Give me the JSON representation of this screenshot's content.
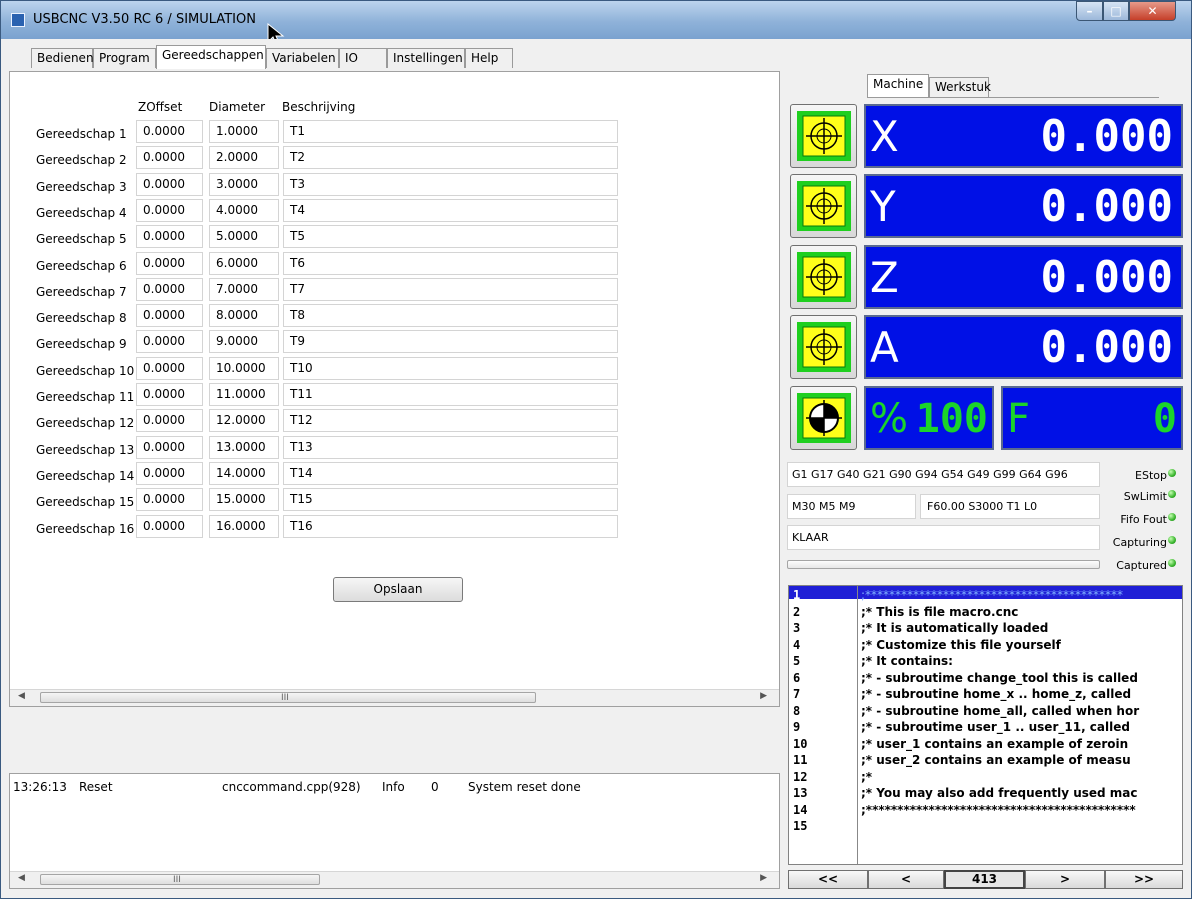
{
  "window": {
    "title": "USBCNC V3.50 RC 6 / SIMULATION"
  },
  "tabs": [
    "Bedienen",
    "Program",
    "Gereedschappen",
    "Variabelen",
    "IO",
    "Instellingen",
    "Help"
  ],
  "tools_table": {
    "headers": {
      "zoffset": "ZOffset",
      "diameter": "Diameter",
      "description": "Beschrijving"
    },
    "rows": [
      {
        "label": "Gereedschap 1",
        "zoffset": "0.0000",
        "diameter": "1.0000",
        "desc": "T1"
      },
      {
        "label": "Gereedschap 2",
        "zoffset": "0.0000",
        "diameter": "2.0000",
        "desc": "T2"
      },
      {
        "label": "Gereedschap 3",
        "zoffset": "0.0000",
        "diameter": "3.0000",
        "desc": "T3"
      },
      {
        "label": "Gereedschap 4",
        "zoffset": "0.0000",
        "diameter": "4.0000",
        "desc": "T4"
      },
      {
        "label": "Gereedschap 5",
        "zoffset": "0.0000",
        "diameter": "5.0000",
        "desc": "T5"
      },
      {
        "label": "Gereedschap 6",
        "zoffset": "0.0000",
        "diameter": "6.0000",
        "desc": "T6"
      },
      {
        "label": "Gereedschap 7",
        "zoffset": "0.0000",
        "diameter": "7.0000",
        "desc": "T7"
      },
      {
        "label": "Gereedschap 8",
        "zoffset": "0.0000",
        "diameter": "8.0000",
        "desc": "T8"
      },
      {
        "label": "Gereedschap 9",
        "zoffset": "0.0000",
        "diameter": "9.0000",
        "desc": "T9"
      },
      {
        "label": "Gereedschap 10",
        "zoffset": "0.0000",
        "diameter": "10.0000",
        "desc": "T10"
      },
      {
        "label": "Gereedschap 11",
        "zoffset": "0.0000",
        "diameter": "11.0000",
        "desc": "T11"
      },
      {
        "label": "Gereedschap 12",
        "zoffset": "0.0000",
        "diameter": "12.0000",
        "desc": "T12"
      },
      {
        "label": "Gereedschap 13",
        "zoffset": "0.0000",
        "diameter": "13.0000",
        "desc": "T13"
      },
      {
        "label": "Gereedschap 14",
        "zoffset": "0.0000",
        "diameter": "14.0000",
        "desc": "T14"
      },
      {
        "label": "Gereedschap 15",
        "zoffset": "0.0000",
        "diameter": "15.0000",
        "desc": "T15"
      },
      {
        "label": "Gereedschap 16",
        "zoffset": "0.0000",
        "diameter": "16.0000",
        "desc": "T16"
      }
    ],
    "save_label": "Opslaan"
  },
  "log": {
    "time": "13:26:13",
    "event": "Reset",
    "source": "cnccommand.cpp(928)",
    "level": "Info",
    "code": "0",
    "message": "System reset done"
  },
  "coord_tabs": [
    "Machine",
    "Werkstuk"
  ],
  "dro": [
    {
      "axis": "X",
      "value": "0.000"
    },
    {
      "axis": "Y",
      "value": "0.000"
    },
    {
      "axis": "Z",
      "value": "0.000"
    },
    {
      "axis": "A",
      "value": "0.000"
    }
  ],
  "feed_override": {
    "symbol": "%",
    "value": "100"
  },
  "feed": {
    "symbol": "F",
    "value": "0"
  },
  "gcodes": "G1 G17 G40 G21 G90 G94 G54 G49 G99 G64 G96",
  "mcodes": "M30 M5 M9",
  "fst": "F60.00 S3000 T1 L0",
  "state": "KLAAR",
  "status_leds": [
    "EStop",
    "SwLimit",
    "Fifo Fout",
    "Capturing",
    "Captured"
  ],
  "code_lines": [
    {
      "n": "1",
      "t": ";*******************************************"
    },
    {
      "n": "2",
      "t": ";* This is file macro.cnc"
    },
    {
      "n": "3",
      "t": ";* It is automatically loaded"
    },
    {
      "n": "4",
      "t": ";* Customize this file yourself"
    },
    {
      "n": "5",
      "t": ";* It contains:"
    },
    {
      "n": "6",
      "t": ";* - subroutime change_tool this is called"
    },
    {
      "n": "7",
      "t": ";* - subroutine home_x .. home_z, called"
    },
    {
      "n": "8",
      "t": ";* - subroutine home_all, called when hor"
    },
    {
      "n": "9",
      "t": ";* - subroutime user_1 .. user_11, called"
    },
    {
      "n": "10",
      "t": ";*    user_1 contains an example of zeroin"
    },
    {
      "n": "11",
      "t": ";*    user_2 contains an example of measu"
    },
    {
      "n": "12",
      "t": ";*"
    },
    {
      "n": "13",
      "t": ";* You may also add frequently used mac"
    },
    {
      "n": "14",
      "t": ";*******************************************"
    },
    {
      "n": "15",
      "t": ""
    }
  ],
  "nav": {
    "first": "<<",
    "prev": "<",
    "count": "413",
    "next": ">",
    "last": ">>"
  },
  "scroll_grip": "III"
}
